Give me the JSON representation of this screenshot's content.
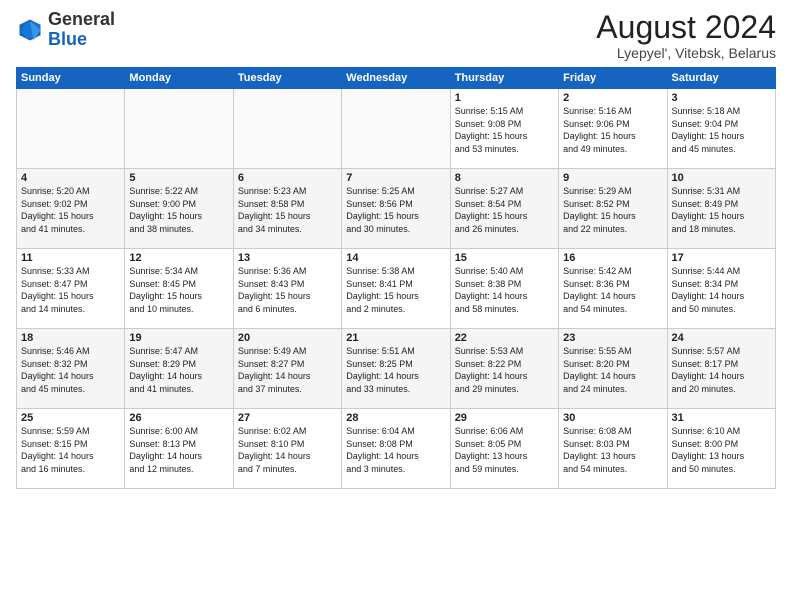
{
  "header": {
    "logo_general": "General",
    "logo_blue": "Blue",
    "month_year": "August 2024",
    "location": "Lyepyel', Vitebsk, Belarus"
  },
  "weekdays": [
    "Sunday",
    "Monday",
    "Tuesday",
    "Wednesday",
    "Thursday",
    "Friday",
    "Saturday"
  ],
  "weeks": [
    [
      {
        "num": "",
        "info": ""
      },
      {
        "num": "",
        "info": ""
      },
      {
        "num": "",
        "info": ""
      },
      {
        "num": "",
        "info": ""
      },
      {
        "num": "1",
        "info": "Sunrise: 5:15 AM\nSunset: 9:08 PM\nDaylight: 15 hours\nand 53 minutes."
      },
      {
        "num": "2",
        "info": "Sunrise: 5:16 AM\nSunset: 9:06 PM\nDaylight: 15 hours\nand 49 minutes."
      },
      {
        "num": "3",
        "info": "Sunrise: 5:18 AM\nSunset: 9:04 PM\nDaylight: 15 hours\nand 45 minutes."
      }
    ],
    [
      {
        "num": "4",
        "info": "Sunrise: 5:20 AM\nSunset: 9:02 PM\nDaylight: 15 hours\nand 41 minutes."
      },
      {
        "num": "5",
        "info": "Sunrise: 5:22 AM\nSunset: 9:00 PM\nDaylight: 15 hours\nand 38 minutes."
      },
      {
        "num": "6",
        "info": "Sunrise: 5:23 AM\nSunset: 8:58 PM\nDaylight: 15 hours\nand 34 minutes."
      },
      {
        "num": "7",
        "info": "Sunrise: 5:25 AM\nSunset: 8:56 PM\nDaylight: 15 hours\nand 30 minutes."
      },
      {
        "num": "8",
        "info": "Sunrise: 5:27 AM\nSunset: 8:54 PM\nDaylight: 15 hours\nand 26 minutes."
      },
      {
        "num": "9",
        "info": "Sunrise: 5:29 AM\nSunset: 8:52 PM\nDaylight: 15 hours\nand 22 minutes."
      },
      {
        "num": "10",
        "info": "Sunrise: 5:31 AM\nSunset: 8:49 PM\nDaylight: 15 hours\nand 18 minutes."
      }
    ],
    [
      {
        "num": "11",
        "info": "Sunrise: 5:33 AM\nSunset: 8:47 PM\nDaylight: 15 hours\nand 14 minutes."
      },
      {
        "num": "12",
        "info": "Sunrise: 5:34 AM\nSunset: 8:45 PM\nDaylight: 15 hours\nand 10 minutes."
      },
      {
        "num": "13",
        "info": "Sunrise: 5:36 AM\nSunset: 8:43 PM\nDaylight: 15 hours\nand 6 minutes."
      },
      {
        "num": "14",
        "info": "Sunrise: 5:38 AM\nSunset: 8:41 PM\nDaylight: 15 hours\nand 2 minutes."
      },
      {
        "num": "15",
        "info": "Sunrise: 5:40 AM\nSunset: 8:38 PM\nDaylight: 14 hours\nand 58 minutes."
      },
      {
        "num": "16",
        "info": "Sunrise: 5:42 AM\nSunset: 8:36 PM\nDaylight: 14 hours\nand 54 minutes."
      },
      {
        "num": "17",
        "info": "Sunrise: 5:44 AM\nSunset: 8:34 PM\nDaylight: 14 hours\nand 50 minutes."
      }
    ],
    [
      {
        "num": "18",
        "info": "Sunrise: 5:46 AM\nSunset: 8:32 PM\nDaylight: 14 hours\nand 45 minutes."
      },
      {
        "num": "19",
        "info": "Sunrise: 5:47 AM\nSunset: 8:29 PM\nDaylight: 14 hours\nand 41 minutes."
      },
      {
        "num": "20",
        "info": "Sunrise: 5:49 AM\nSunset: 8:27 PM\nDaylight: 14 hours\nand 37 minutes."
      },
      {
        "num": "21",
        "info": "Sunrise: 5:51 AM\nSunset: 8:25 PM\nDaylight: 14 hours\nand 33 minutes."
      },
      {
        "num": "22",
        "info": "Sunrise: 5:53 AM\nSunset: 8:22 PM\nDaylight: 14 hours\nand 29 minutes."
      },
      {
        "num": "23",
        "info": "Sunrise: 5:55 AM\nSunset: 8:20 PM\nDaylight: 14 hours\nand 24 minutes."
      },
      {
        "num": "24",
        "info": "Sunrise: 5:57 AM\nSunset: 8:17 PM\nDaylight: 14 hours\nand 20 minutes."
      }
    ],
    [
      {
        "num": "25",
        "info": "Sunrise: 5:59 AM\nSunset: 8:15 PM\nDaylight: 14 hours\nand 16 minutes."
      },
      {
        "num": "26",
        "info": "Sunrise: 6:00 AM\nSunset: 8:13 PM\nDaylight: 14 hours\nand 12 minutes."
      },
      {
        "num": "27",
        "info": "Sunrise: 6:02 AM\nSunset: 8:10 PM\nDaylight: 14 hours\nand 7 minutes."
      },
      {
        "num": "28",
        "info": "Sunrise: 6:04 AM\nSunset: 8:08 PM\nDaylight: 14 hours\nand 3 minutes."
      },
      {
        "num": "29",
        "info": "Sunrise: 6:06 AM\nSunset: 8:05 PM\nDaylight: 13 hours\nand 59 minutes."
      },
      {
        "num": "30",
        "info": "Sunrise: 6:08 AM\nSunset: 8:03 PM\nDaylight: 13 hours\nand 54 minutes."
      },
      {
        "num": "31",
        "info": "Sunrise: 6:10 AM\nSunset: 8:00 PM\nDaylight: 13 hours\nand 50 minutes."
      }
    ]
  ]
}
